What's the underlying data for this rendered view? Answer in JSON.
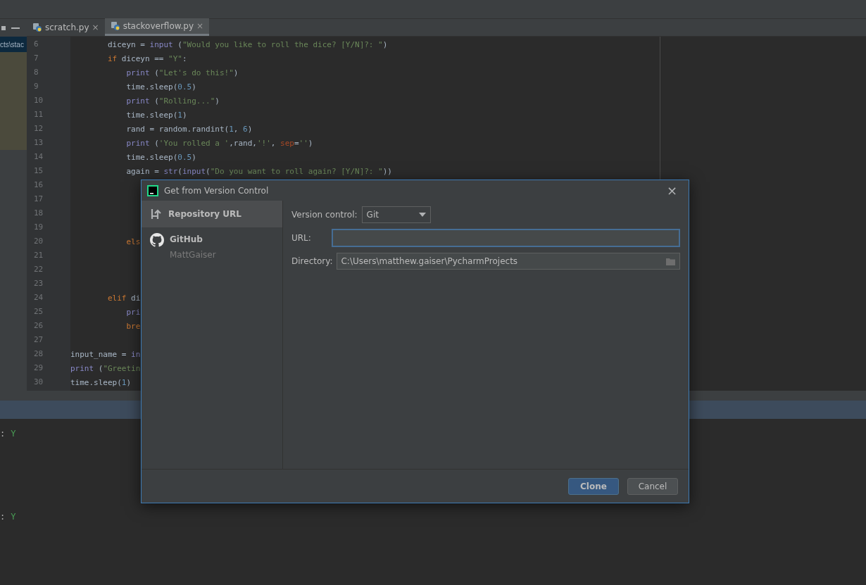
{
  "project_panel": {
    "path": "cts\\stac"
  },
  "tabs": [
    {
      "label": "scratch.py",
      "close": "×",
      "selected": false
    },
    {
      "label": "stackoverflow.py",
      "close": "×",
      "selected": true
    }
  ],
  "editor": {
    "lines": [
      {
        "number": "6",
        "tokens": [
          {
            "kind": "plain",
            "text": "        diceyn = "
          },
          {
            "kind": "builtin",
            "text": "input"
          },
          {
            "kind": "plain",
            "text": " ("
          },
          {
            "kind": "string",
            "text": "\"Would you like to roll the dice? [Y/N]?: \""
          },
          {
            "kind": "plain",
            "text": ")"
          }
        ]
      },
      {
        "number": "7",
        "tokens": [
          {
            "kind": "keyword",
            "text": "        if"
          },
          {
            "kind": "plain",
            "text": " diceyn == "
          },
          {
            "kind": "string",
            "text": "\"Y\""
          },
          {
            "kind": "plain",
            "text": ":"
          }
        ]
      },
      {
        "number": "8",
        "tokens": [
          {
            "kind": "builtin",
            "text": "            print"
          },
          {
            "kind": "plain",
            "text": " ("
          },
          {
            "kind": "string",
            "text": "\"Let's do this!\""
          },
          {
            "kind": "plain",
            "text": ")"
          }
        ]
      },
      {
        "number": "9",
        "tokens": [
          {
            "kind": "plain",
            "text": "            time.sleep("
          },
          {
            "kind": "number",
            "text": "0.5"
          },
          {
            "kind": "plain",
            "text": ")"
          }
        ]
      },
      {
        "number": "10",
        "tokens": [
          {
            "kind": "builtin",
            "text": "            print"
          },
          {
            "kind": "plain",
            "text": " ("
          },
          {
            "kind": "string",
            "text": "\"Rolling...\""
          },
          {
            "kind": "plain",
            "text": ")"
          }
        ]
      },
      {
        "number": "11",
        "tokens": [
          {
            "kind": "plain",
            "text": "            time.sleep("
          },
          {
            "kind": "number",
            "text": "1"
          },
          {
            "kind": "plain",
            "text": ")"
          }
        ]
      },
      {
        "number": "12",
        "tokens": [
          {
            "kind": "plain",
            "text": "            rand = random.randint("
          },
          {
            "kind": "number",
            "text": "1"
          },
          {
            "kind": "plain",
            "text": ", "
          },
          {
            "kind": "number",
            "text": "6"
          },
          {
            "kind": "plain",
            "text": ")"
          }
        ]
      },
      {
        "number": "13",
        "tokens": [
          {
            "kind": "builtin",
            "text": "            print"
          },
          {
            "kind": "plain",
            "text": " ("
          },
          {
            "kind": "string",
            "text": "'You rolled a '"
          },
          {
            "kind": "plain",
            "text": ",rand,"
          },
          {
            "kind": "string",
            "text": "'!'"
          },
          {
            "kind": "plain",
            "text": ", "
          },
          {
            "kind": "param",
            "text": "sep"
          },
          {
            "kind": "plain",
            "text": "="
          },
          {
            "kind": "string",
            "text": "''"
          },
          {
            "kind": "plain",
            "text": ")"
          }
        ]
      },
      {
        "number": "14",
        "tokens": [
          {
            "kind": "plain",
            "text": "            time.sleep("
          },
          {
            "kind": "number",
            "text": "0.5"
          },
          {
            "kind": "plain",
            "text": ")"
          }
        ]
      },
      {
        "number": "15",
        "tokens": [
          {
            "kind": "plain",
            "text": "            again = "
          },
          {
            "kind": "builtin",
            "text": "str"
          },
          {
            "kind": "plain",
            "text": "("
          },
          {
            "kind": "builtin",
            "text": "input"
          },
          {
            "kind": "plain",
            "text": "("
          },
          {
            "kind": "string",
            "text": "\"Do you want to roll again? [Y/N]?: \""
          },
          {
            "kind": "plain",
            "text": "))"
          }
        ]
      },
      {
        "number": "16"
      },
      {
        "number": "17"
      },
      {
        "number": "18"
      },
      {
        "number": "19"
      },
      {
        "number": "20",
        "tokens": [
          {
            "kind": "keyword",
            "text": "            els"
          }
        ]
      },
      {
        "number": "21"
      },
      {
        "number": "22"
      },
      {
        "number": "23"
      },
      {
        "number": "24",
        "tokens": [
          {
            "kind": "keyword",
            "text": "        elif"
          },
          {
            "kind": "plain",
            "text": " di"
          }
        ]
      },
      {
        "number": "25",
        "tokens": [
          {
            "kind": "builtin",
            "text": "            pri"
          }
        ]
      },
      {
        "number": "26",
        "tokens": [
          {
            "kind": "keyword",
            "text": "            bre"
          }
        ]
      },
      {
        "number": "27"
      },
      {
        "number": "28",
        "tokens": [
          {
            "kind": "plain",
            "text": "input_name = "
          },
          {
            "kind": "builtin",
            "text": "in"
          }
        ]
      },
      {
        "number": "29",
        "tokens": [
          {
            "kind": "builtin",
            "text": "print"
          },
          {
            "kind": "plain",
            "text": " ("
          },
          {
            "kind": "string",
            "text": "\"Greetin"
          }
        ]
      },
      {
        "number": "30",
        "tokens": [
          {
            "kind": "plain",
            "text": "time.sleep("
          },
          {
            "kind": "number",
            "text": "1"
          },
          {
            "kind": "plain",
            "text": ")"
          }
        ]
      }
    ]
  },
  "console": {
    "lines": [
      {
        "prompt": ":",
        "answer": "Y"
      },
      {
        "prompt": ":",
        "answer": "Y"
      }
    ]
  },
  "dialog": {
    "title": "Get from Version Control",
    "close": "×",
    "sources": [
      {
        "kind": "url",
        "label": "Repository URL",
        "selected": true
      },
      {
        "kind": "github",
        "label": "GitHub",
        "account": "MattGaiser",
        "selected": false
      }
    ],
    "version_control": {
      "label": "Version control:",
      "value": "Git"
    },
    "url": {
      "label": "URL:"
    },
    "directory": {
      "label": "Directory:",
      "value": "C:\\Users\\matthew.gaiser\\PycharmProjects"
    },
    "buttons": [
      {
        "label": "Clone",
        "kind": "primary"
      },
      {
        "label": "Cancel",
        "kind": "secondary"
      }
    ]
  }
}
